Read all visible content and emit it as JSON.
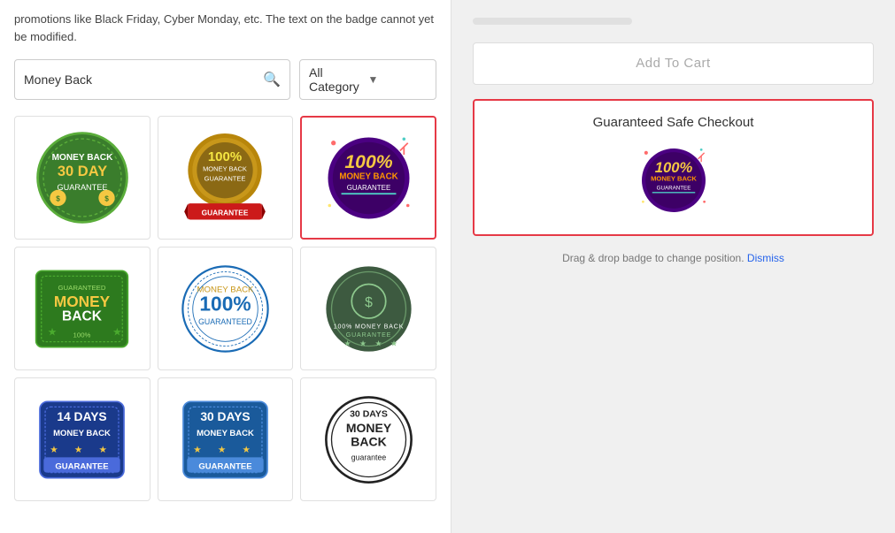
{
  "left": {
    "notice_text": "promotions like Black Friday, Cyber Monday, etc. The text on the badge cannot yet be modified.",
    "search": {
      "placeholder": "Money Back",
      "value": "Money Back"
    },
    "category": {
      "label": "All Category"
    },
    "badges": [
      {
        "id": 1,
        "alt": "Green 30 day money back guarantee",
        "selected": false,
        "row": 1,
        "col": 1
      },
      {
        "id": 2,
        "alt": "Gold 100% money back guarantee",
        "selected": false,
        "row": 1,
        "col": 2
      },
      {
        "id": 3,
        "alt": "100% money back guarantee colorful",
        "selected": true,
        "row": 1,
        "col": 3
      },
      {
        "id": 4,
        "alt": "Guaranteed Money Back 100%",
        "selected": false,
        "row": 2,
        "col": 1
      },
      {
        "id": 5,
        "alt": "100% Money Back Guaranteed blue circle",
        "selected": false,
        "row": 2,
        "col": 2
      },
      {
        "id": 6,
        "alt": "100% Money Back Guarantee dark circle",
        "selected": false,
        "row": 2,
        "col": 3
      },
      {
        "id": 7,
        "alt": "14 Days Money Back Guarantee",
        "selected": false,
        "row": 3,
        "col": 1
      },
      {
        "id": 8,
        "alt": "30 Days Money Back Guarantee blue",
        "selected": false,
        "row": 3,
        "col": 2
      },
      {
        "id": 9,
        "alt": "30 Days Money Back guarantee black",
        "selected": false,
        "row": 3,
        "col": 3
      }
    ]
  },
  "right": {
    "add_to_cart_label": "Add To Cart",
    "checkout_title": "Guaranteed Safe Checkout",
    "dismiss_text": "Drag & drop badge to change position.",
    "dismiss_link": "Dismiss"
  }
}
